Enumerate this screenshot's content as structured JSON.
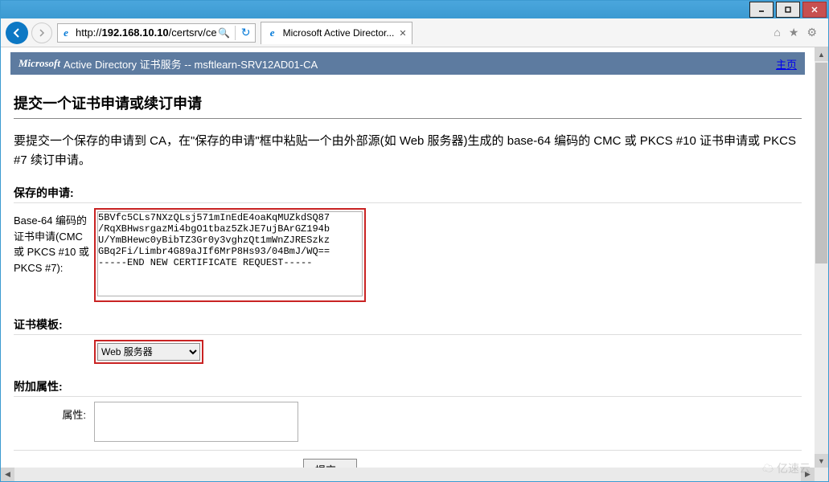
{
  "titlebar": {},
  "nav": {
    "url_prefix": "http://",
    "url_ip": "192.168.10.10",
    "url_suffix": "/certsrv/ce",
    "search_icon": "🔍",
    "refresh_icon": "↻",
    "tab_title": "Microsoft Active Director...",
    "tab_close": "✕",
    "home_icon": "⌂",
    "star_icon": "★",
    "gear_icon": "⚙"
  },
  "banner": {
    "ms": "Microsoft",
    "rest": " Active Directory 证书服务  --  msftlearn-SRV12AD01-CA",
    "home": "主页"
  },
  "page": {
    "heading": "提交一个证书申请或续订申请",
    "intro": "要提交一个保存的申请到 CA，在\"保存的申请\"框中粘贴一个由外部源(如 Web 服务器)生成的 base-64 编码的 CMC 或 PKCS #10 证书申请或 PKCS #7 续订申请。",
    "saved_req_label": "保存的申请:",
    "saved_req_side": "Base-64 编码的证书申请(CMC 或 PKCS #10 或 PKCS #7):",
    "textarea_value": "5BVfc5CLs7NXzQLsj571mInEdE4oaKqMUZkdSQ87\n/RqXBHwsrgazMi4bgO1tbaz5ZkJE7ujBArGZ194b\nU/YmBHewc0yBibTZ3Gr0y3vghzQt1mWnZJRESzkz\nGBq2Fi/Limbr4G89aJIf6MrP8Hs93/04BmJ/WQ==\n-----END NEW CERTIFICATE REQUEST-----",
    "tmpl_label": "证书模板:",
    "tmpl_value": "Web 服务器",
    "attr_label": "附加属性:",
    "attr_side": "属性:",
    "submit": "提交 >"
  },
  "watermark": "亿速云"
}
